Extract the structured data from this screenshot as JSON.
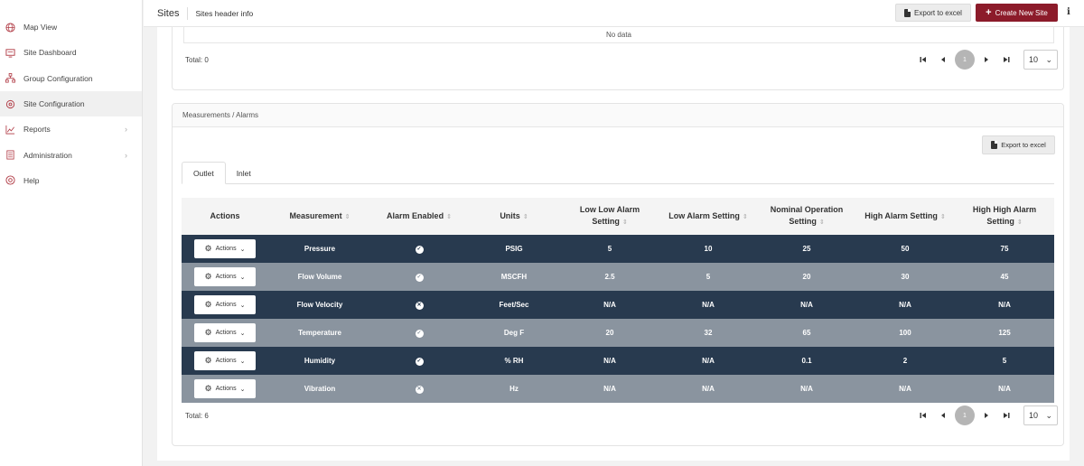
{
  "sidebar": {
    "items": [
      {
        "label": "Map View",
        "icon": "globe-icon",
        "chevron": false,
        "active": false
      },
      {
        "label": "Site Dashboard",
        "icon": "monitor-icon",
        "chevron": false,
        "active": false
      },
      {
        "label": "Group Configuration",
        "icon": "sitemap-icon",
        "chevron": false,
        "active": false
      },
      {
        "label": "Site Configuration",
        "icon": "site-gear-icon",
        "chevron": false,
        "active": true
      },
      {
        "label": "Reports",
        "icon": "chart-line-icon",
        "chevron": true,
        "active": false
      },
      {
        "label": "Administration",
        "icon": "building-icon",
        "chevron": true,
        "active": false
      },
      {
        "label": "Help",
        "icon": "lifebuoy-icon",
        "chevron": false,
        "active": false
      }
    ]
  },
  "header": {
    "title": "Sites",
    "info": "Sites header info",
    "export_label": "Export to excel",
    "create_label": "Create New Site",
    "info_icon": "i"
  },
  "top_panel": {
    "no_data": "No data",
    "total": "Total: 0",
    "page": "1",
    "page_size": "10"
  },
  "measurements": {
    "title": "Measurements / Alarms",
    "export_label": "Export to excel",
    "tabs": [
      {
        "label": "Outlet",
        "active": true
      },
      {
        "label": "Inlet",
        "active": false
      }
    ],
    "columns": [
      "Actions",
      "Measurement",
      "Alarm Enabled",
      "Units",
      "Low Low Alarm Setting",
      "Low Alarm Setting",
      "Nominal Operation Setting",
      "High Alarm Setting",
      "High High Alarm Setting"
    ],
    "action_label": "Actions",
    "rows": [
      {
        "measurement": "Pressure",
        "enabled": true,
        "units": "PSIG",
        "low_low": "5",
        "low": "10",
        "nominal": "25",
        "high": "50",
        "high_high": "75"
      },
      {
        "measurement": "Flow Volume",
        "enabled": true,
        "units": "MSCFH",
        "low_low": "2.5",
        "low": "5",
        "nominal": "20",
        "high": "30",
        "high_high": "45"
      },
      {
        "measurement": "Flow Velocity",
        "enabled": false,
        "units": "Feet/Sec",
        "low_low": "N/A",
        "low": "N/A",
        "nominal": "N/A",
        "high": "N/A",
        "high_high": "N/A"
      },
      {
        "measurement": "Temperature",
        "enabled": true,
        "units": "Deg F",
        "low_low": "20",
        "low": "32",
        "nominal": "65",
        "high": "100",
        "high_high": "125"
      },
      {
        "measurement": "Humidity",
        "enabled": true,
        "units": "% RH",
        "low_low": "N/A",
        "low": "N/A",
        "nominal": "0.1",
        "high": "2",
        "high_high": "5"
      },
      {
        "measurement": "Vibration",
        "enabled": false,
        "units": "Hz",
        "low_low": "N/A",
        "low": "N/A",
        "nominal": "N/A",
        "high": "N/A",
        "high_high": "N/A"
      }
    ],
    "total": "Total: 6",
    "page": "1",
    "page_size": "10"
  },
  "colors": {
    "brand": "#8c1b2a",
    "row_dark": "#283a4f",
    "row_light": "#8a949f"
  }
}
